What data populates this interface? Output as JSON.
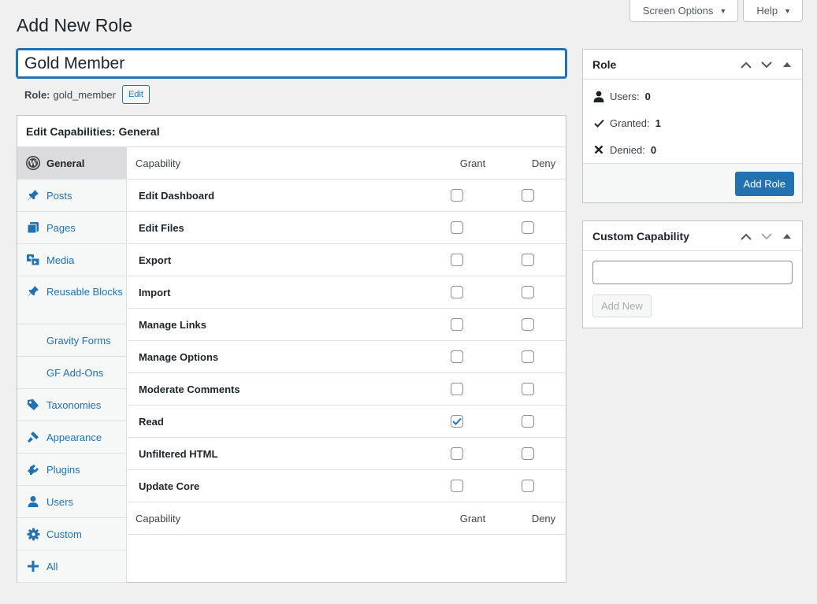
{
  "screen_meta": {
    "screen_options_label": "Screen Options",
    "help_label": "Help"
  },
  "page": {
    "title": "Add New Role",
    "role_name_value": "Gold Member",
    "slug_label": "Role:",
    "slug_value": "gold_member",
    "slug_edit_label": "Edit"
  },
  "capabilities": {
    "header": "Edit Capabilities: General",
    "sidebar": [
      {
        "label": "General",
        "icon": "wordpress-icon",
        "active": true
      },
      {
        "label": "Posts",
        "icon": "pushpin-icon"
      },
      {
        "label": "Pages",
        "icon": "pages-icon"
      },
      {
        "label": "Media",
        "icon": "media-icon"
      },
      {
        "label": "Reusable Blocks",
        "icon": "pushpin-icon"
      },
      {
        "label": "Gravity Forms",
        "icon": ""
      },
      {
        "label": "GF Add-Ons",
        "icon": ""
      },
      {
        "label": "Taxonomies",
        "icon": "tag-icon"
      },
      {
        "label": "Appearance",
        "icon": "brush-icon"
      },
      {
        "label": "Plugins",
        "icon": "plugin-icon"
      },
      {
        "label": "Users",
        "icon": "user-icon"
      },
      {
        "label": "Custom",
        "icon": "gear-icon"
      },
      {
        "label": "All",
        "icon": "plus-icon"
      }
    ],
    "columns": {
      "capability": "Capability",
      "grant": "Grant",
      "deny": "Deny"
    },
    "rows": [
      {
        "name": "Edit Dashboard",
        "grant": false,
        "deny": false
      },
      {
        "name": "Edit Files",
        "grant": false,
        "deny": false
      },
      {
        "name": "Export",
        "grant": false,
        "deny": false
      },
      {
        "name": "Import",
        "grant": false,
        "deny": false
      },
      {
        "name": "Manage Links",
        "grant": false,
        "deny": false
      },
      {
        "name": "Manage Options",
        "grant": false,
        "deny": false
      },
      {
        "name": "Moderate Comments",
        "grant": false,
        "deny": false
      },
      {
        "name": "Read",
        "grant": true,
        "deny": false
      },
      {
        "name": "Unfiltered HTML",
        "grant": false,
        "deny": false
      },
      {
        "name": "Update Core",
        "grant": false,
        "deny": false
      }
    ]
  },
  "role_box": {
    "title": "Role",
    "users_label": "Users:",
    "users_value": "0",
    "granted_label": "Granted:",
    "granted_value": "1",
    "denied_label": "Denied:",
    "denied_value": "0",
    "add_role_label": "Add Role"
  },
  "custom_capability": {
    "title": "Custom Capability",
    "input_value": "",
    "add_new_label": "Add New"
  },
  "colors": {
    "accent": "#2271b1",
    "background": "#f0f0f1",
    "link": "#2271b1"
  }
}
